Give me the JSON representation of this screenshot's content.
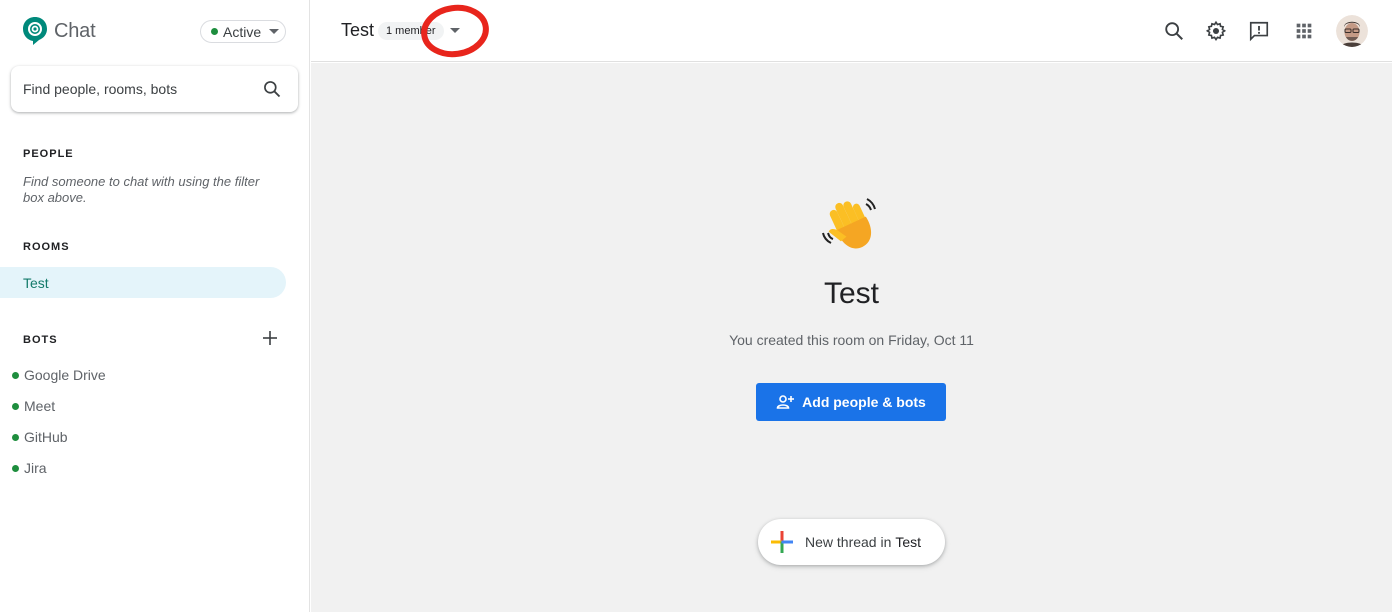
{
  "app": {
    "name": "Chat"
  },
  "status": {
    "label": "Active",
    "color": "#1e8e3e"
  },
  "search": {
    "placeholder": "Find people, rooms, bots"
  },
  "sidebar": {
    "people_label": "PEOPLE",
    "people_hint": "Find someone to chat with using the filter box above.",
    "rooms_label": "ROOMS",
    "rooms": [
      {
        "label": "Test",
        "selected": true
      }
    ],
    "bots_label": "BOTS",
    "bots": [
      {
        "label": "Google Drive",
        "online": true
      },
      {
        "label": "Meet",
        "online": true
      },
      {
        "label": "GitHub",
        "online": true
      },
      {
        "label": "Jira",
        "online": true
      }
    ]
  },
  "header": {
    "room_title": "Test",
    "member_count": "1 member",
    "icons": [
      "search-icon",
      "settings-icon",
      "feedback-icon",
      "apps-grid-icon",
      "avatar"
    ]
  },
  "main": {
    "emoji": "waving-hand",
    "title": "Test",
    "subtitle": "You created this room on Friday, Oct 11",
    "add_button": "Add people & bots",
    "new_thread_prefix": "New thread in",
    "new_thread_room": "Test"
  },
  "colors": {
    "accent": "#1a73e8",
    "selected_bg": "#e4f4fa",
    "selected_text": "#137a6a",
    "annotation": "#e8251c"
  }
}
